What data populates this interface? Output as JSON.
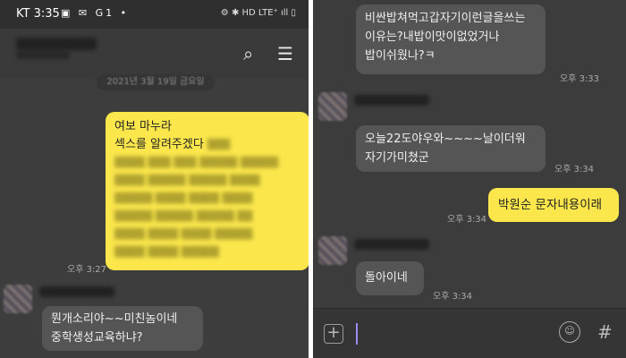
{
  "left": {
    "status": {
      "carrier": "KT",
      "time": "3:35",
      "icons": "▣ ✉ G1 •",
      "right_icons": "⚙ ✱ HD LTE⁺ ıll ▯"
    },
    "date_pill": "2021년 3월 19일 금요일",
    "msg1": {
      "line1": "여보 마누라",
      "line2": "섹스를 알려주겠다",
      "time": "오후 3:27"
    },
    "msg2": {
      "line1": "뭔개소리야~~미친놈이네",
      "line2": "중학생성교육하냐?"
    }
  },
  "right": {
    "msg_top": {
      "line1": "비싼밥쳐먹고갑자기이런글을쓰는",
      "line2": "이유는?내밥이맛이없었거나",
      "line3": "밥이쉬웠나?ㅋ",
      "time": "오후 3:33"
    },
    "msg2": {
      "line1": "오늘22도야우와~~~~날이더워",
      "line2": "자기가미쳤군",
      "time": "오후 3:34"
    },
    "msg3": {
      "text": "박원순 문자내용이래",
      "time": "오후 3:34"
    },
    "msg4": {
      "text": "돌아이네",
      "time": "오후 3:34"
    },
    "input": {
      "plus": "+",
      "emoji": "☺",
      "hash": "#"
    }
  }
}
